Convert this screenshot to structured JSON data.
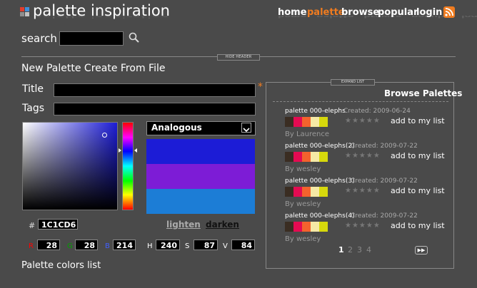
{
  "header": {
    "logo_text": "palette inspiration",
    "logo_colors": [
      "#e23c2c",
      "#3f8fd9",
      "#8f8f8f",
      "#c2c2c2"
    ],
    "nav": [
      {
        "label": "home",
        "active": false
      },
      {
        "label": "palette",
        "active": true
      },
      {
        "label": "browse",
        "active": false
      },
      {
        "label": "popular",
        "active": false
      },
      {
        "label": "login",
        "active": false
      }
    ],
    "rss_icon": "rss-icon",
    "search_label": "search",
    "search_value": "",
    "search_icon": "magnifier-icon",
    "hide_header_label": "HIDE HEADER"
  },
  "form": {
    "title": "New Palette Create From File",
    "title_label": "Title",
    "title_value": "",
    "tags_label": "Tags",
    "tags_value": "",
    "required_mark": "*"
  },
  "picker": {
    "base_color": "#1C1CD6",
    "hue_level": 0.34,
    "sv_cursor": {
      "saturation": 0.87,
      "value": 0.84
    },
    "scheme": "Analogous",
    "scheme_colors": [
      "#1C1CD6",
      "#7D1CD6",
      "#1C7DD6"
    ],
    "lighten_label": "lighten",
    "darken_label": "darken",
    "hash_label": "#",
    "hex": "1C1CD6",
    "rgb": {
      "r_label": "R",
      "r": "28",
      "g_label": "G",
      "g": "28",
      "b_label": "B",
      "b": "214"
    },
    "hsv": {
      "h_label": "H",
      "h": "240",
      "s_label": "S",
      "s": "87",
      "v_label": "V",
      "v": "84"
    },
    "r_label_color": "#ff0000",
    "g_label_color": "#00a000",
    "b_label_color": "#3f5fff"
  },
  "colors_list_label": "Palette colors list",
  "browse": {
    "expand_label": "EXPAND LIST",
    "title": "Browse Palettes",
    "palettes": [
      {
        "name": "palette 000-elephs",
        "created": "Created: 2009-06-24",
        "by": "By Laurence",
        "colors": [
          "#3a2d22",
          "#e40b52",
          "#f4622d",
          "#f5e9a5",
          "#d6d80c"
        ],
        "add": "add to my list",
        "stars": "★★★★★"
      },
      {
        "name": "palette 000-elephs(2)",
        "created": "Created: 2009-07-22",
        "by": "By wesley",
        "colors": [
          "#3a2d22",
          "#e40b52",
          "#f4622d",
          "#f5e9a5",
          "#d6d80c"
        ],
        "add": "add to my list",
        "stars": "★★★★★"
      },
      {
        "name": "palette 000-elephs(3)",
        "created": "Created: 2009-07-22",
        "by": "By wesley",
        "colors": [
          "#3a2d22",
          "#e40b52",
          "#f4622d",
          "#f5e9a5",
          "#d6d80c"
        ],
        "add": "add to my list",
        "stars": "★★★★★"
      },
      {
        "name": "palette 000-elephs(4)",
        "created": "Created: 2009-07-22",
        "by": "By wesley",
        "colors": [
          "#3a2d22",
          "#e40b52",
          "#f4622d",
          "#f5e9a5",
          "#d6d80c"
        ],
        "add": "add to my list",
        "stars": "★★★★★"
      }
    ],
    "pages": [
      "1",
      "2",
      "3",
      "4"
    ],
    "current_page": "1",
    "next_label": "▶▶"
  },
  "colors": {
    "background": "#4a4a4a",
    "accent": "#f07c20"
  }
}
